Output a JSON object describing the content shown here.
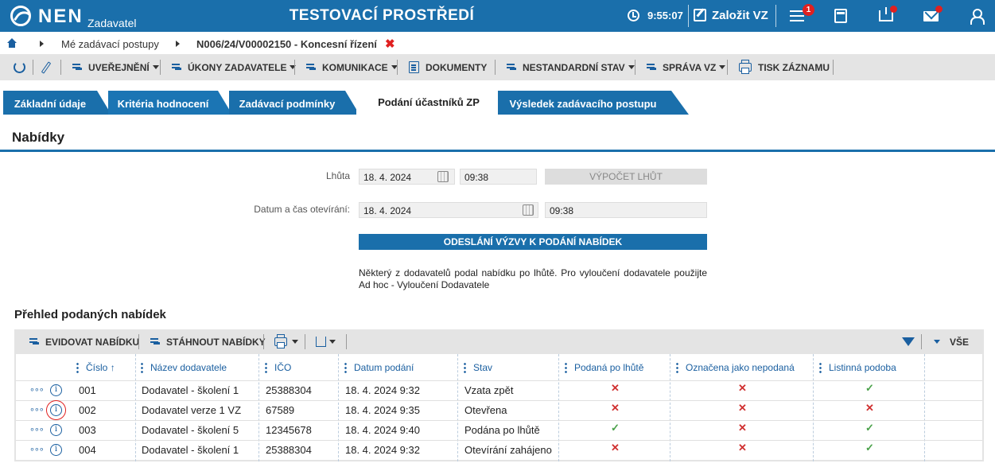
{
  "app": {
    "logo_text": "NEN",
    "logo_subtitle": "Zadavatel",
    "environment_title": "TESTOVACÍ PROSTŘEDÍ",
    "time": "9:55:07",
    "create_label": "Založit VZ",
    "menu_badge": "1"
  },
  "breadcrumb": {
    "item1": "Mé zadávací postupy",
    "item2": "N006/24/V00002150 - Koncesní řízení",
    "close": "✖"
  },
  "toolbar": {
    "uverejneni": "UVEŘEJNĚNÍ",
    "ukony": "ÚKONY ZADAVATELE",
    "komunikace": "KOMUNIKACE",
    "dokumenty": "DOKUMENTY",
    "nestandardni": "NESTANDARDNÍ STAV",
    "sprava": "SPRÁVA VZ",
    "tisk": "TISK ZÁZNAMU"
  },
  "tabs": [
    "Základní údaje",
    "Kritéria hodnocení",
    "Zadávací podmínky",
    "Podání účastníků ZP",
    "Výsledek zadávacího postupu"
  ],
  "section": {
    "title": "Nabídky",
    "overview_title": "Přehled podaných nabídek"
  },
  "form": {
    "lhuta_label": "Lhůta",
    "lhuta_date": "18. 4. 2024",
    "lhuta_time": "09:38",
    "vypocet_button": "VÝPOČET LHŮT",
    "otevirani_label": "Datum a čas otevírání:",
    "otevirani_date": "18. 4. 2024",
    "otevirani_time": "09:38",
    "odeslani_button": "ODESLÁNÍ VÝZVY K PODÁNÍ NABÍDEK",
    "warning": "Některý z dodavatelů podal nabídku po lhůtě. Pro vyloučení dodavatele použijte Ad hoc - Vyloučení Dodavatele"
  },
  "grid_toolbar": {
    "evidovat": "EVIDOVAT NABÍDKU",
    "stahnout": "STÁHNOUT NABÍDKY",
    "vse": "VŠE"
  },
  "grid": {
    "columns": [
      "Číslo",
      "Název dodavatele",
      "IČO",
      "Datum podání",
      "Stav",
      "Podaná po lhůtě",
      "Označena jako nepodaná",
      "Listinná podoba"
    ],
    "sort_indicator": "↑",
    "rows": [
      {
        "cislo": "001",
        "nazev": "Dodavatel - školení 1",
        "ico": "25388304",
        "datum": "18. 4. 2024 9:32",
        "stav": "Vzata zpět",
        "po_lhute": "✕",
        "nepodana": "✕",
        "listinna": "✓"
      },
      {
        "cislo": "002",
        "nazev": "Dodavatel verze 1 VZ",
        "ico": "67589",
        "datum": "18. 4. 2024 9:35",
        "stav": "Otevřena",
        "po_lhute": "✕",
        "nepodana": "✕",
        "listinna": "✕"
      },
      {
        "cislo": "003",
        "nazev": "Dodavatel - školení 5",
        "ico": "12345678",
        "datum": "18. 4. 2024 9:40",
        "stav": "Podána po lhůtě",
        "po_lhute": "✓",
        "nepodana": "✕",
        "listinna": "✓"
      },
      {
        "cislo": "004",
        "nazev": "Dodavatel - školení 1",
        "ico": "25388304",
        "datum": "18. 4. 2024 9:32",
        "stav": "Otevírání zahájeno",
        "po_lhute": "✕",
        "nepodana": "✕",
        "listinna": "✓"
      }
    ]
  },
  "colors": {
    "brand": "#1a6fab",
    "error": "#d03030",
    "ok": "#4aa14a"
  }
}
